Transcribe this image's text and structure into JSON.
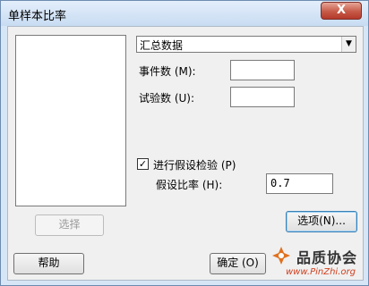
{
  "window": {
    "title": "单样本比率",
    "close_symbol": "X"
  },
  "data_type": {
    "selected": "汇总数据"
  },
  "fields": {
    "events_label": "事件数 (M):",
    "events_value": "",
    "trials_label": "试验数 (U):",
    "trials_value": ""
  },
  "hypothesis": {
    "checkbox_label": "进行假设检验 (P)",
    "checked": true,
    "check_mark": "✓",
    "ratio_label": "假设比率 (H):",
    "ratio_value": "0.7"
  },
  "buttons": {
    "select": "选择",
    "options": "选项(N)...",
    "help": "帮助",
    "ok": "确定 (O)"
  },
  "watermark": {
    "brand": "品质协会",
    "url": "www.PinZhi.org"
  }
}
